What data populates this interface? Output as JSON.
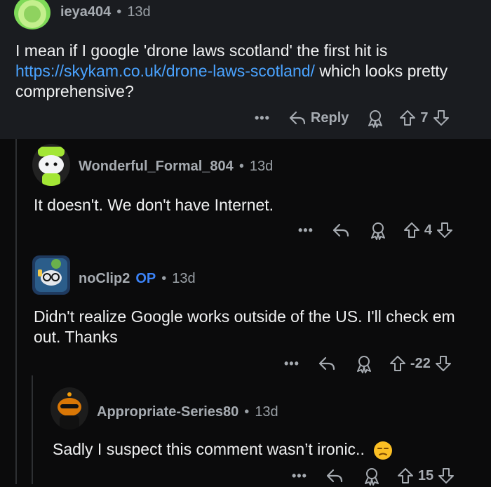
{
  "comments": [
    {
      "username": "ieya404",
      "age": "13d",
      "body_pre": "I mean if I google 'drone laws scotland' the first hit is",
      "link": "https://skykam.co.uk/drone-laws-scotland/",
      "body_post": "which looks pretty comprehensive?",
      "reply_label": "Reply",
      "score": "7"
    },
    {
      "username": "Wonderful_Formal_804",
      "age": "13d",
      "body": "It doesn't. We don't have Internet.",
      "score": "4"
    },
    {
      "username": "noClip2",
      "op_badge": "OP",
      "age": "13d",
      "body": "Didn't realize Google works outside of the US. I'll check em out. Thanks",
      "score": "-22"
    },
    {
      "username": "Appropriate-Series80",
      "age": "13d",
      "body": "Sadly I suspect this comment wasn’t ironic..",
      "score": "15"
    }
  ],
  "separator": "•",
  "more_glyph": "•••",
  "colors": {
    "link": "#4aa3ff",
    "op": "#3b82f6",
    "highlight_bg": "#1a1c20",
    "bg": "#0b0b0c"
  }
}
